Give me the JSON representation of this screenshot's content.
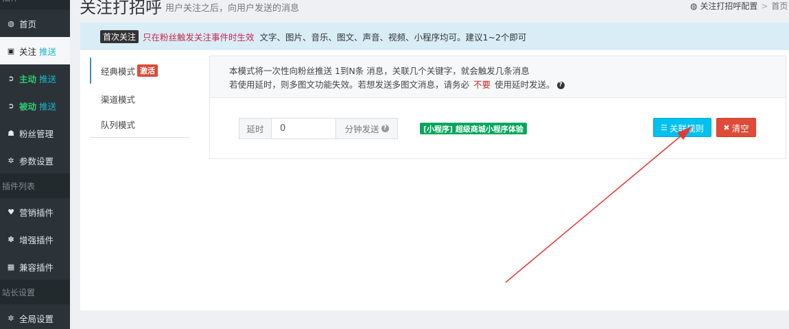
{
  "sidebar": {
    "items": [
      {
        "icon": "dashboard-icon",
        "glyph": "◍",
        "label": "首页"
      },
      {
        "icon": "rss-icon",
        "glyph": "▣",
        "label": "关注",
        "label2": "推送"
      },
      {
        "icon": "circle-arrow-icon",
        "glyph": "➲",
        "label": "主动",
        "label2": "推送"
      },
      {
        "icon": "circle-arrow-icon",
        "glyph": "➲",
        "label": "被动",
        "label2": "推送"
      },
      {
        "icon": "users-icon",
        "glyph": "☗",
        "label": "粉丝管理"
      },
      {
        "icon": "gear-icon",
        "glyph": "✲",
        "label": "参数设置"
      },
      {
        "icon": "heart-icon",
        "glyph": "♥",
        "label": "营销插件"
      },
      {
        "icon": "paw-icon",
        "glyph": "✽",
        "label": "增强插件"
      },
      {
        "icon": "grid-icon",
        "glyph": "▦",
        "label": "兼容插件"
      },
      {
        "icon": "gear-icon",
        "glyph": "✲",
        "label": "全局设置"
      }
    ],
    "sections": [
      "插件列表",
      "站长设置"
    ],
    "top_cut": "插件"
  },
  "header": {
    "title": "关注打招呼",
    "subtitle": "用户关注之后，向用户发送的消息",
    "breadcrumb": [
      "关注打招呼配置",
      "首页"
    ]
  },
  "infobar": {
    "badge": "首次关注",
    "warning": "只在粉丝触发关注事件时生效",
    "text": "文字、图片、音乐、图文、声音、视频、小程序均可。建议1~2个即可"
  },
  "tabs": [
    {
      "label": "经典模式",
      "badge": "激活"
    },
    {
      "label": "渠道模式"
    },
    {
      "label": "队列模式"
    }
  ],
  "notice": {
    "line1": "本模式将一次性向粉丝推送 1到N条 消息，关联几个关键字，就会触发几条消息",
    "line2_a": "若使用延时，则多图文功能失效。若想发送多图文消息，请务必",
    "line2_b": "不要",
    "line2_c": "使用延时发送。"
  },
  "form": {
    "delay_label": "延时",
    "delay_value": "0",
    "delay_unit": "分钟发送",
    "mini_program": "[小程序] 超级商城小程序体验"
  },
  "buttons": {
    "link_rules": "关联规则",
    "clear": "清空"
  },
  "colors": {
    "sidebar_bg": "#2b3338",
    "info_bg": "#d9edf7",
    "btn_info": "#00c0ef",
    "btn_danger": "#dd4b39",
    "badge_green": "#00a65a",
    "arrow": "#e53935"
  }
}
